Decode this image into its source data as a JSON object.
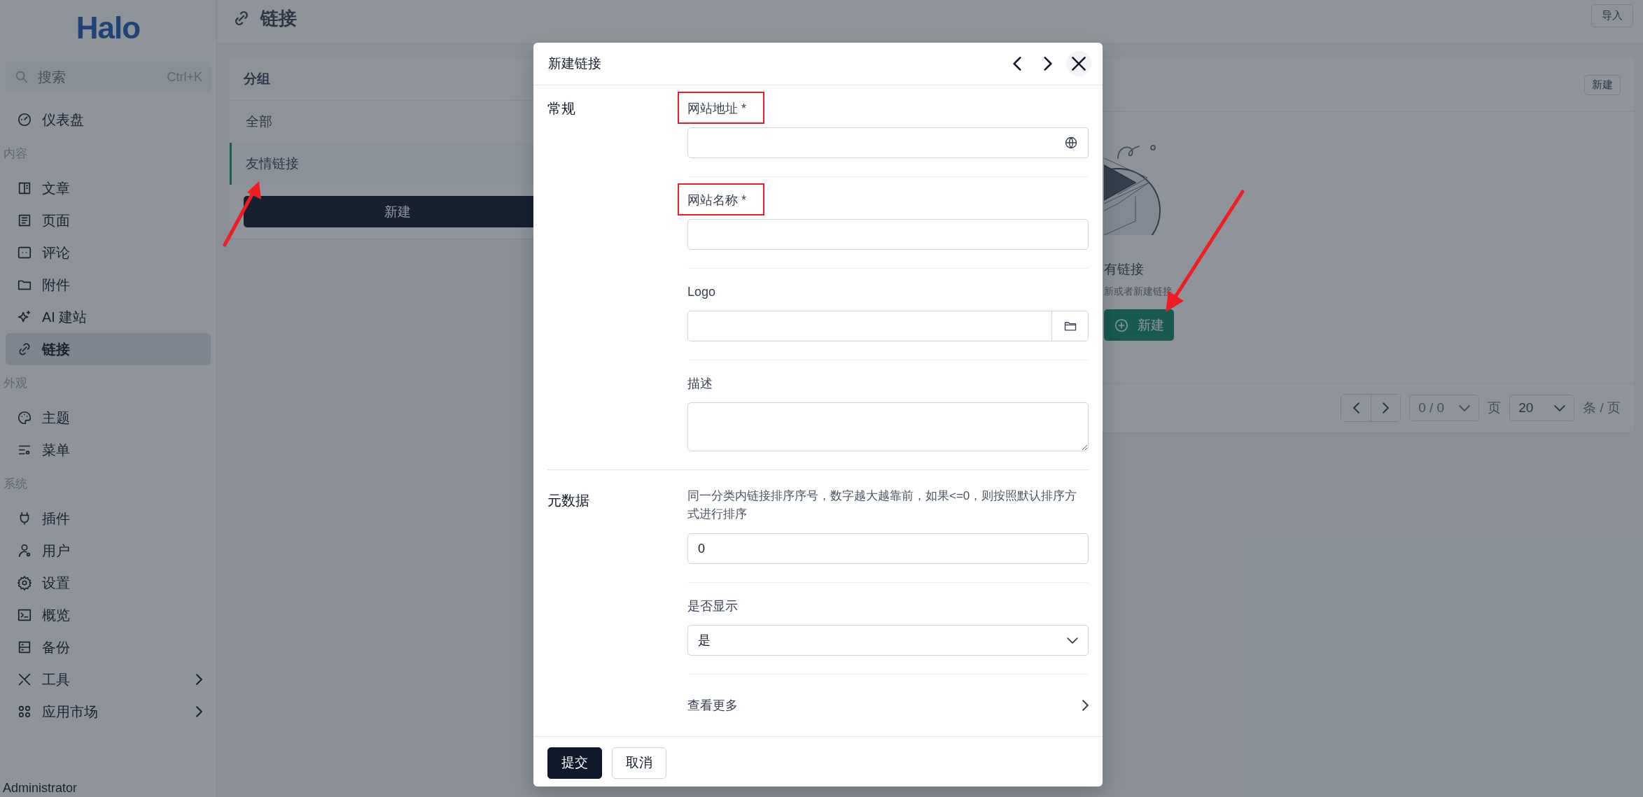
{
  "sidebar": {
    "logo": "Halo",
    "search": {
      "placeholder": "搜索",
      "shortcut": "Ctrl+K"
    },
    "sections": [
      {
        "items": [
          {
            "label": "仪表盘",
            "selected": false,
            "expandable": false
          }
        ]
      },
      {
        "title": "内容",
        "items": [
          {
            "label": "文章",
            "selected": false,
            "expandable": false
          },
          {
            "label": "页面",
            "selected": false,
            "expandable": false
          },
          {
            "label": "评论",
            "selected": false,
            "expandable": false
          },
          {
            "label": "附件",
            "selected": false,
            "expandable": false
          },
          {
            "label": "AI 建站",
            "selected": false,
            "expandable": false
          },
          {
            "label": "链接",
            "selected": true,
            "expandable": false
          }
        ]
      },
      {
        "title": "外观",
        "items": [
          {
            "label": "主题",
            "selected": false,
            "expandable": false
          },
          {
            "label": "菜单",
            "selected": false,
            "expandable": false
          }
        ]
      },
      {
        "title": "系统",
        "items": [
          {
            "label": "插件",
            "selected": false,
            "expandable": false
          },
          {
            "label": "用户",
            "selected": false,
            "expandable": false
          },
          {
            "label": "设置",
            "selected": false,
            "expandable": false
          },
          {
            "label": "概览",
            "selected": false,
            "expandable": false
          },
          {
            "label": "备份",
            "selected": false,
            "expandable": false
          },
          {
            "label": "工具",
            "selected": false,
            "expandable": true
          },
          {
            "label": "应用市场",
            "selected": false,
            "expandable": true
          }
        ]
      }
    ],
    "user": "Administrator"
  },
  "header": {
    "title": "链接",
    "import_button": "导入"
  },
  "groups": {
    "title": "分组",
    "items": [
      {
        "label": "全部",
        "selected": false,
        "annotated": false
      },
      {
        "label": "友情链接",
        "selected": true,
        "annotated": true
      }
    ],
    "new_button": "新建"
  },
  "links": {
    "new_button": "新建",
    "empty_title": "有链接",
    "empty_hint": "新或者新建链接",
    "empty_button": {
      "label": "新建",
      "annotated": true
    },
    "pagination": {
      "page": "0 / 0",
      "page_unit": "页",
      "page_size": "20",
      "size_unit": "条 / 页"
    }
  },
  "dialog": {
    "title": "新建链接",
    "sections": [
      {
        "title": "常规",
        "fields": [
          {
            "kind": "url",
            "label": "网站地址 *",
            "highlighted": true
          },
          {
            "kind": "text",
            "label": "网站名称 *",
            "highlighted": true
          },
          {
            "kind": "attachment",
            "label": "Logo",
            "highlighted": false
          },
          {
            "kind": "textarea",
            "label": "描述",
            "highlighted": false
          }
        ]
      },
      {
        "title": "元数据",
        "fields": [
          {
            "kind": "number",
            "label": "同一分类内链接排序序号，数字越大越靠前，如果<=0，则按照默认排序方式进行排序",
            "value": "0",
            "highlighted": false
          },
          {
            "kind": "select",
            "label": "是否显示",
            "value": "是",
            "highlighted": false
          },
          {
            "kind": "more",
            "label": "查看更多",
            "highlighted": false
          }
        ]
      }
    ],
    "buttons": [
      {
        "label": "提交",
        "primary": true
      },
      {
        "label": "取消",
        "primary": false
      }
    ]
  }
}
